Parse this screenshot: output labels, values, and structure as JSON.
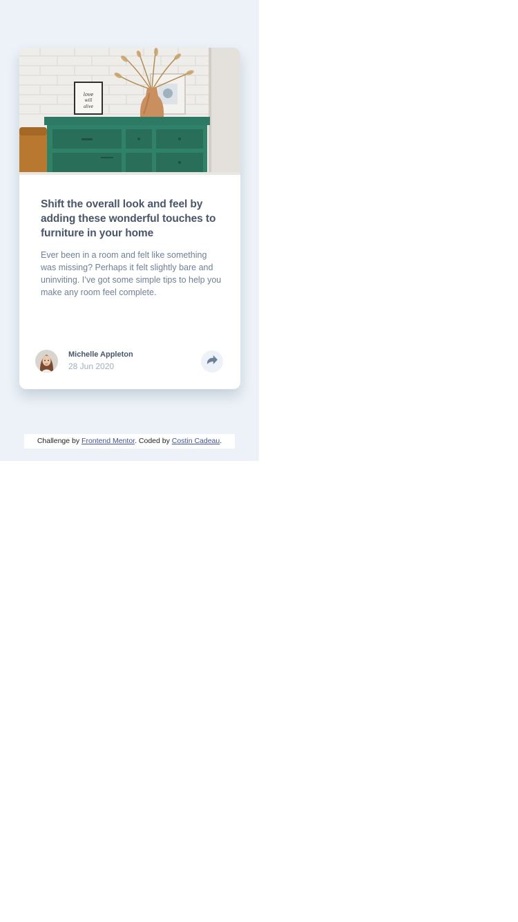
{
  "article": {
    "title": "Shift the overall look and feel by adding these wonderful touches to furniture in your home",
    "description": "Ever been in a room and felt like something was missing? Perhaps it felt slightly bare and uninviting. I’ve got some simple tips to help you make any room feel complete.",
    "image_icon": "drawers-photo"
  },
  "author": {
    "name": "Michelle Appleton",
    "date": "28 Jun 2020",
    "avatar_icon": "avatar-photo"
  },
  "share": {
    "icon": "share-icon"
  },
  "attribution": {
    "prefix": "Challenge by ",
    "link1": "Frontend Mentor",
    "middle": ". Coded by ",
    "link2": "Costin Cadeau",
    "suffix": "."
  },
  "colors": {
    "background": "#ECF2F8",
    "title": "#48556A",
    "body": "#6E8098",
    "muted": "#9EAFC2",
    "link": "#3E52A3"
  }
}
